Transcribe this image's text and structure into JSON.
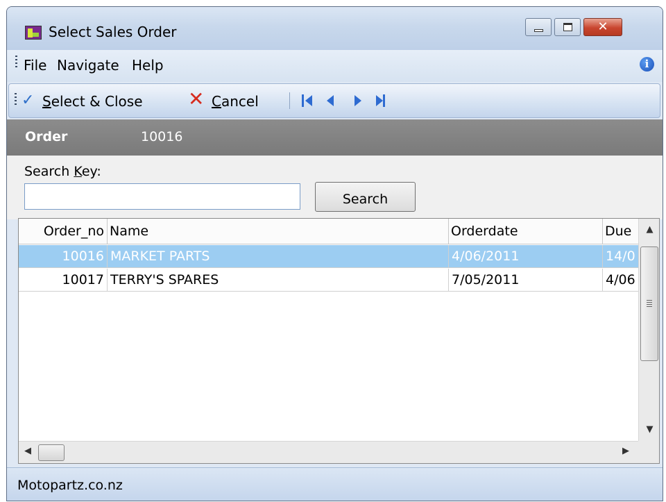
{
  "window": {
    "title": "Select Sales Order"
  },
  "menu": {
    "items": [
      "File",
      "Navigate",
      "Help"
    ]
  },
  "toolbar": {
    "select_close_prefix": "S",
    "select_close_rest": "elect & Close",
    "cancel_prefix": "C",
    "cancel_rest": "ancel",
    "nav_icons": [
      "first-record-icon",
      "previous-record-icon",
      "next-record-icon",
      "last-record-icon"
    ]
  },
  "header": {
    "label": "Order",
    "value": "10016"
  },
  "search": {
    "label_prefix": "Search ",
    "label_accel": "K",
    "label_rest": "ey:",
    "value": "",
    "button_label": "Search"
  },
  "grid": {
    "columns": [
      "Order_no",
      "Name",
      "Orderdate",
      "Due"
    ],
    "rows": [
      {
        "order_no": "10016",
        "name": "MARKET PARTS",
        "orderdate": "4/06/2011",
        "due": "14/0",
        "selected": true
      },
      {
        "order_no": "10017",
        "name": "TERRY'S SPARES",
        "orderdate": "7/05/2011",
        "due": "4/06",
        "selected": false
      }
    ]
  },
  "status": {
    "text": "Motopartz.co.nz"
  },
  "colors": {
    "selection": "#9ccdf2",
    "header_band": "#808080",
    "nav_arrows": "#2e6bd1",
    "cancel_x": "#d62b1f"
  }
}
